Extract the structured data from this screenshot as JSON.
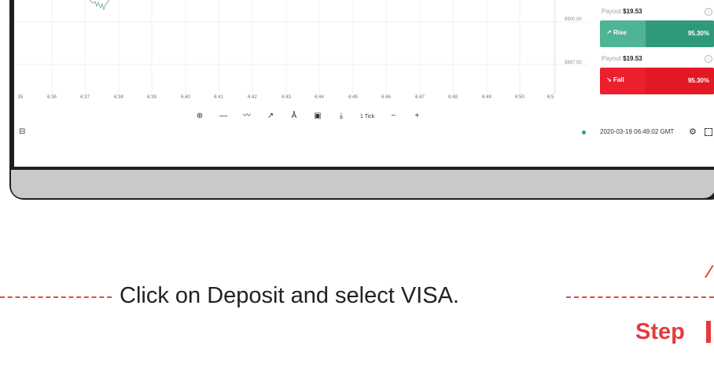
{
  "chart": {
    "price_labels": [
      "8900.00",
      "8897.50"
    ],
    "time_ticks": [
      "35",
      "6:36",
      "6:37",
      "6:38",
      "6:39",
      "6:40",
      "6:41",
      "6:42",
      "6:43",
      "6:44",
      "6:45",
      "6:46",
      "6:47",
      "6:48",
      "6:49",
      "6:50",
      "6:5"
    ]
  },
  "toolbar": {
    "items": [
      {
        "icon": "crosshair-icon",
        "glyph": "⊕"
      },
      {
        "icon": "horizontal-line-icon",
        "glyph": "—"
      },
      {
        "icon": "trend-line-icon",
        "glyph": "〰"
      },
      {
        "icon": "arrow-line-icon",
        "glyph": "↗"
      },
      {
        "icon": "compass-icon",
        "glyph": "Å"
      },
      {
        "icon": "chart-template-icon",
        "glyph": "▣"
      },
      {
        "icon": "download-icon",
        "glyph": "⤓"
      }
    ],
    "interval_label": "1 Tick",
    "zoom_out": "−",
    "zoom_in": "+"
  },
  "footer": {
    "clock": "2020-03-19 06:49:02 GMT",
    "status_color": "#21a67a"
  },
  "panel": {
    "rise": {
      "payout_prefix": "Payout ",
      "payout_value": "$19.53",
      "label": "Rise",
      "arrow": "↗",
      "percent": "95.30%",
      "color": "#2f9a79"
    },
    "fall": {
      "payout_prefix": "Payout ",
      "payout_value": "$19.53",
      "label": "Fall",
      "arrow": "↘",
      "percent": "95.30%",
      "color": "#e21825"
    }
  },
  "instruction": {
    "text": "Click on Deposit and select VISA.",
    "step": "Step",
    "accent": "#e53b3b"
  }
}
